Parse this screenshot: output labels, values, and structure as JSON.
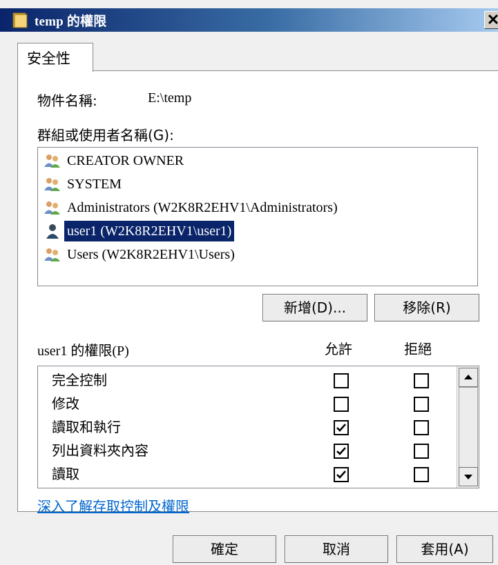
{
  "window": {
    "title": "temp 的權限",
    "close_label": "✕"
  },
  "tabs": [
    {
      "label": "安全性"
    }
  ],
  "object": {
    "label": "物件名稱:",
    "value": "E:\\temp"
  },
  "principals_label": "群組或使用者名稱(G):",
  "principals": [
    {
      "name": "CREATOR OWNER",
      "icon": "group-icon",
      "selected": false
    },
    {
      "name": "SYSTEM",
      "icon": "group-icon",
      "selected": false
    },
    {
      "name": "Administrators (W2K8R2EHV1\\Administrators)",
      "icon": "group-icon",
      "selected": false
    },
    {
      "name": "user1 (W2K8R2EHV1\\user1)",
      "icon": "user-icon",
      "selected": true
    },
    {
      "name": "Users (W2K8R2EHV1\\Users)",
      "icon": "group-icon",
      "selected": false
    }
  ],
  "buttons": {
    "add": "新增(D)...",
    "remove": "移除(R)",
    "ok": "確定",
    "cancel": "取消",
    "apply": "套用(A)"
  },
  "permissions": {
    "header": "user1 的權限(P)",
    "allow_header": "允許",
    "deny_header": "拒絕",
    "rows": [
      {
        "name": "完全控制",
        "allow": false,
        "deny": false
      },
      {
        "name": "修改",
        "allow": false,
        "deny": false
      },
      {
        "name": "讀取和執行",
        "allow": true,
        "deny": false
      },
      {
        "name": "列出資料夾內容",
        "allow": true,
        "deny": false
      },
      {
        "name": "讀取",
        "allow": true,
        "deny": false
      }
    ]
  },
  "help_link": "深入了解存取控制及權限",
  "colors": {
    "selection": "#0a246a",
    "link": "#0066cc"
  }
}
